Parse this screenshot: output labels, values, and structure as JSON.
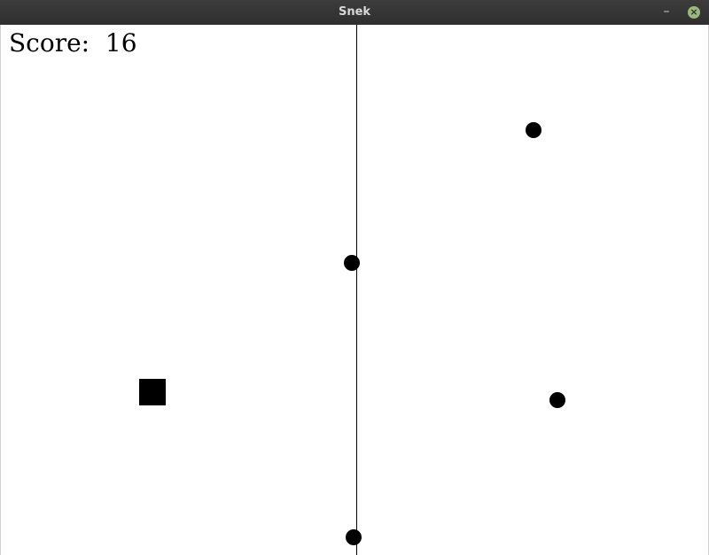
{
  "window": {
    "title": "Snek",
    "minimize_icon": "minimize-icon",
    "close_icon": "close-icon",
    "close_color": "#9bb77c"
  },
  "hud": {
    "score_label": "Score:",
    "score_value": "16"
  },
  "game": {
    "background": "#ffffff",
    "foreground": "#000000",
    "player_shape": "square",
    "ball_shape": "circle",
    "ball_count": 4
  }
}
